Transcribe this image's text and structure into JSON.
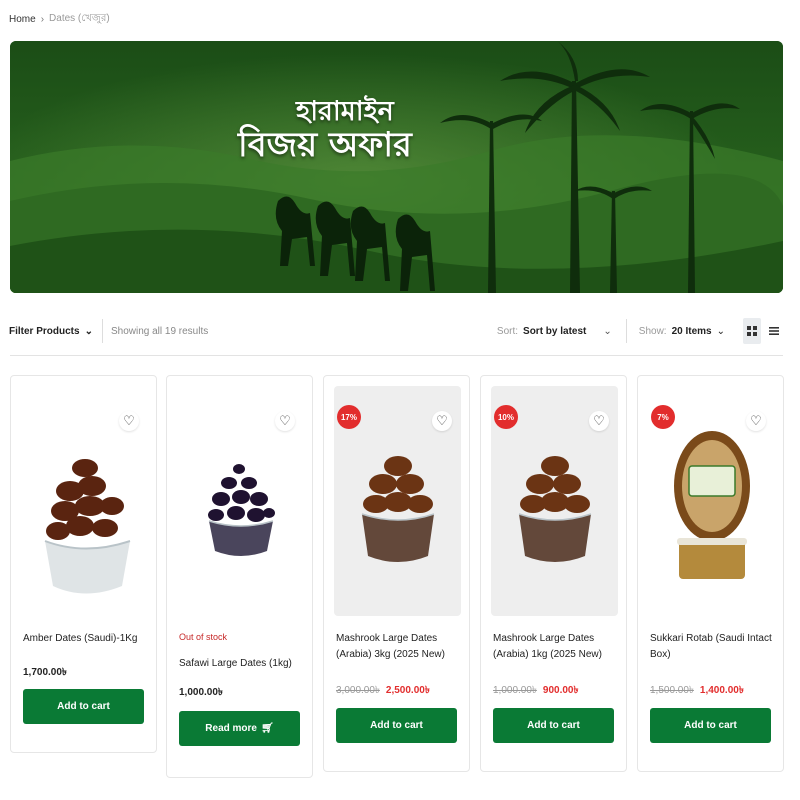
{
  "breadcrumb": {
    "home": "Home",
    "separator": "›",
    "current": "Dates (খেজুর)"
  },
  "banner": {
    "line1": "হারামাইন",
    "line2": "বিজয় অফার"
  },
  "toolbar": {
    "filter_label": "Filter Products",
    "showing": "Showing all 19 results",
    "sort_label": "Sort:",
    "sort_value": "Sort by latest",
    "show_label": "Show:",
    "show_value": "20 Items"
  },
  "colors": {
    "accent_green": "#0a7a35",
    "sale_red": "#e22d2d"
  },
  "products": [
    {
      "name": "Amber Dates (Saudi)-1Kg",
      "price": "1,700.00৳",
      "button": "Add to cart"
    },
    {
      "stock": "Out of stock",
      "name": "Safawi Large Dates (1kg)",
      "price": "1,000.00৳",
      "button": "Read more"
    },
    {
      "badge": "17%",
      "name": "Mashrook Large Dates (Arabia) 3kg (2025 New)",
      "old_price": "3,000.00৳",
      "price": "2,500.00৳",
      "button": "Add to cart"
    },
    {
      "badge": "10%",
      "name": "Mashrook Large Dates (Arabia) 1kg (2025 New)",
      "old_price": "1,000.00৳",
      "price": "900.00৳",
      "button": "Add to cart"
    },
    {
      "badge": "7%",
      "name": "Sukkari Rotab (Saudi Intact Box)",
      "old_price": "1,500.00৳",
      "price": "1,400.00৳",
      "button": "Add to cart"
    }
  ]
}
